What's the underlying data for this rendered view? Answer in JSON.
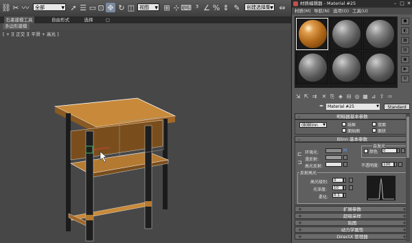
{
  "toolbar": {
    "selection_filter": "全部",
    "view_dropdown": "视图",
    "named_selection": "创建选择集",
    "icons": [
      "link-icon",
      "unlink-icon",
      "bind-space-warp-icon",
      "select-icon",
      "select-by-name-icon",
      "rect-select-icon",
      "window-crossing-icon",
      "move-icon",
      "rotate-icon",
      "scale-icon",
      "pivot-icon",
      "snap-icon",
      "angle-snap-icon",
      "percent-snap-icon",
      "spinner-snap-icon",
      "mirror-icon",
      "align-icon",
      "layer-icon",
      "curve-editor-icon",
      "schematic-icon",
      "material-editor-icon",
      "render-setup-icon"
    ]
  },
  "ribbon": {
    "tabs": [
      "石墨建模工具",
      "自由形式",
      "选择"
    ],
    "active_tab": "石墨建模工具",
    "sub_tab": "多边形建模",
    "toggle": "▢"
  },
  "viewport": {
    "label": "[ + ][ 正交 ][ 平滑 + 高光 ]"
  },
  "material_editor": {
    "title": "材质编辑器 - Material #25",
    "menu": [
      "材质(M)",
      "导航(N)",
      "选项(O)",
      "工具(U)"
    ],
    "material_name": "Material #25",
    "material_type": "Standard",
    "shader_rollout": {
      "title": "明暗器基本参数",
      "shader": "(B)Blinn",
      "options": [
        "线框",
        "双面",
        "面贴图",
        "面状"
      ]
    },
    "blinn_rollout": {
      "title": "Blinn 基本参数",
      "self_illum_group": "自发光",
      "color_label": "颜色",
      "color_value": "0",
      "ambient": "环境光:",
      "diffuse": "漫反射:",
      "specular": "高光反射:",
      "map_letter": "M",
      "opacity_label": "不透明度:",
      "opacity_value": "100",
      "ambient_color": "#8a8a8a",
      "diffuse_color": "#9a9a9a",
      "specular_color": "#e6e6e6"
    },
    "specular_highlights": {
      "group_label": "反射高光",
      "specular_level_label": "高光级别:",
      "specular_level_value": "0",
      "glossiness_label": "光泽度:",
      "glossiness_value": "10",
      "soften_label": "柔化:",
      "soften_value": "0.1"
    },
    "rollouts": [
      "扩展参数",
      "超级采样",
      "贴图",
      "动力学属性",
      "DirectX 管理器"
    ]
  },
  "colors": {
    "wood_top": "#c78a3a",
    "wood_side": "#8b5a22",
    "leg_dark": "#1a1a1a",
    "edge_highlight": "#ffffff",
    "selection_green": "#4aa05a"
  }
}
